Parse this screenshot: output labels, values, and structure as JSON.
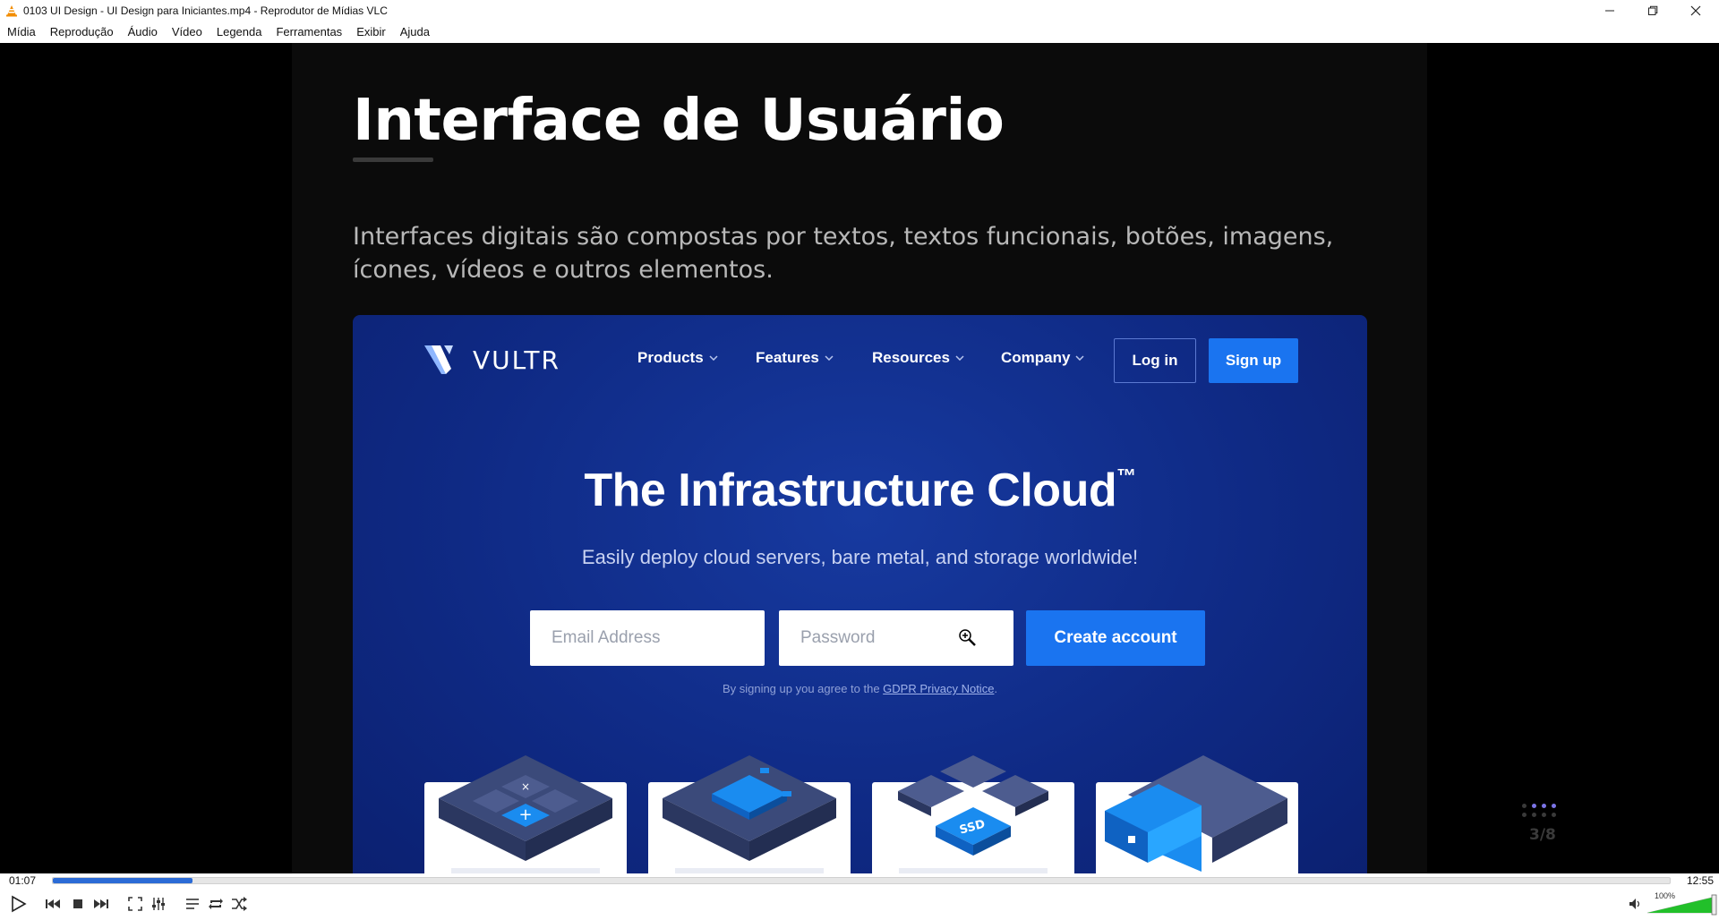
{
  "window": {
    "title": "0103 UI Design - UI Design para Iniciantes.mp4 - Reprodutor de Mídias VLC"
  },
  "menu": [
    "Mídia",
    "Reprodução",
    "Áudio",
    "Vídeo",
    "Legenda",
    "Ferramentas",
    "Exibir",
    "Ajuda"
  ],
  "slide": {
    "title": "Interface de Usuário",
    "text": "Interfaces digitais são compostas por textos, textos funcionais, botões, imagens, ícones, vídeos e outros elementos.",
    "pager": "3/8"
  },
  "vultr": {
    "logo": "VULTR",
    "nav": [
      "Products",
      "Features",
      "Resources",
      "Company"
    ],
    "login": "Log in",
    "signup": "Sign up",
    "hero": "The Infrastructure Cloud",
    "hero_mark": "™",
    "subtitle": "Easily deploy cloud servers, bare metal, and storage worldwide!",
    "email_placeholder": "Email Address",
    "password_placeholder": "Password",
    "create": "Create account",
    "terms_prefix": "By signing up you agree to the ",
    "terms_link": "GDPR Privacy Notice",
    "terms_suffix": ".",
    "ssd_label": "SSD"
  },
  "player": {
    "current_time": "01:07",
    "total_time": "12:55",
    "progress": 0.0865,
    "volume": "100%",
    "volume_level": 1.0
  },
  "colors": {
    "accent": "#2b6bd6",
    "vultr_bg": "#0f2a85",
    "vultr_button": "#1a74f0",
    "pager_active": "#7b73e6"
  }
}
